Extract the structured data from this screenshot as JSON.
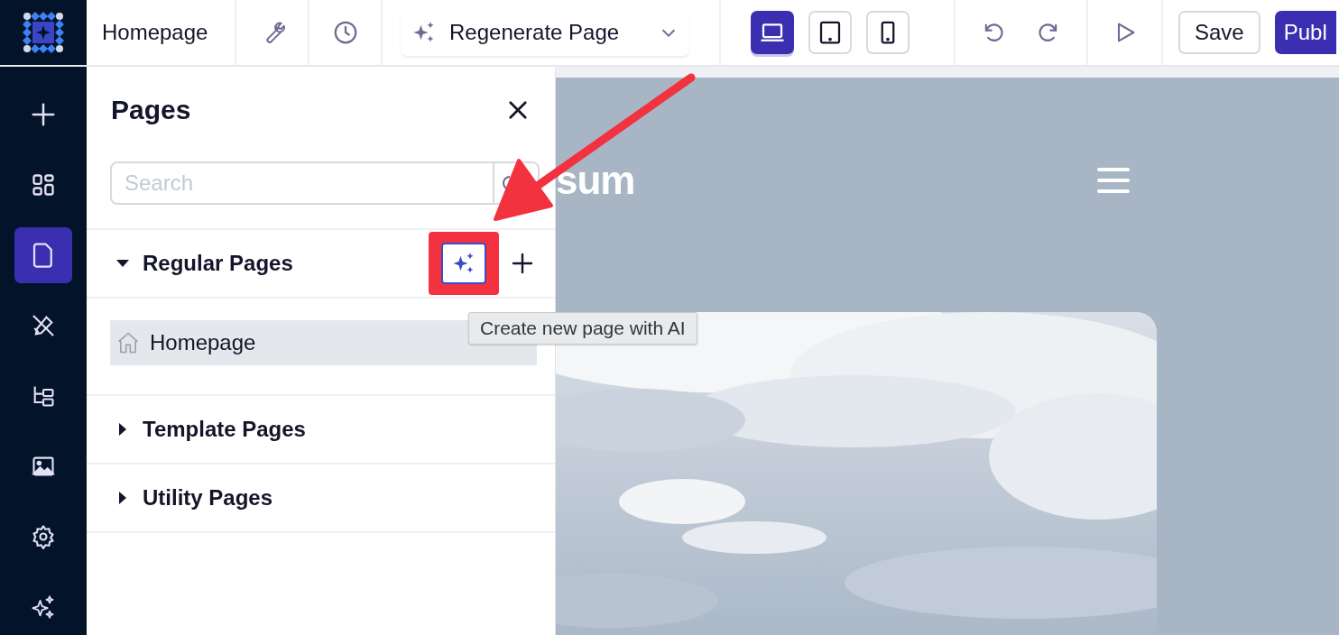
{
  "topbar": {
    "page_name": "Homepage",
    "tools": [
      {
        "kind": "wrench"
      },
      {
        "kind": "clock"
      }
    ],
    "regenerate": {
      "label": "Regenerate Page"
    },
    "devices": [
      {
        "kind": "desktop",
        "selected": true
      },
      {
        "kind": "tablet",
        "selected": false
      },
      {
        "kind": "phone",
        "selected": false
      }
    ],
    "history": [
      {
        "kind": "undo"
      },
      {
        "kind": "redo"
      }
    ],
    "save": "Save",
    "publish": "Publ"
  },
  "rail": [
    {
      "kind": "add",
      "selected": false
    },
    {
      "kind": "widgets",
      "selected": false
    },
    {
      "kind": "pages",
      "selected": true
    },
    {
      "kind": "design",
      "selected": false
    },
    {
      "kind": "tree",
      "selected": false
    },
    {
      "kind": "media",
      "selected": false
    },
    {
      "kind": "settings",
      "selected": false
    },
    {
      "kind": "ai",
      "selected": false
    }
  ],
  "panel": {
    "title": "Pages",
    "search": {
      "placeholder": "Search"
    },
    "sections": [
      {
        "label": "Regular Pages",
        "expanded": true,
        "children": [
          {
            "label": "Homepage",
            "selected": true
          }
        ]
      },
      {
        "label": "Template Pages",
        "expanded": false
      },
      {
        "label": "Utility Pages",
        "expanded": false
      }
    ]
  },
  "tooltip": "Create new page with AI",
  "preview": {
    "logo": "sum"
  }
}
